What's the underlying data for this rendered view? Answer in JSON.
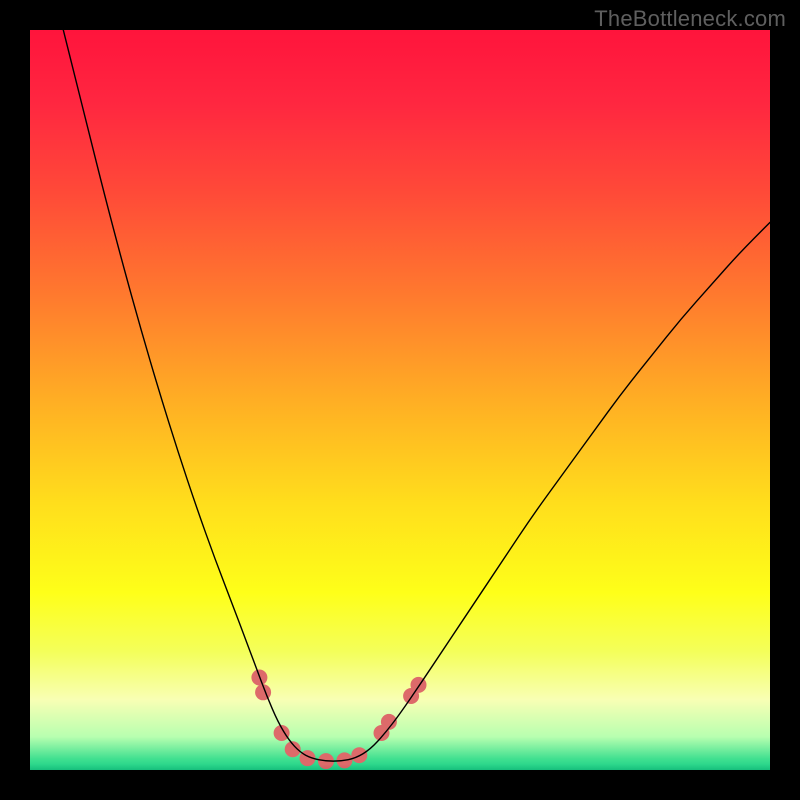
{
  "watermark": "TheBottleneck.com",
  "chart_data": {
    "type": "line",
    "title": "",
    "xlabel": "",
    "ylabel": "",
    "xlim": [
      0,
      100
    ],
    "ylim": [
      0,
      100
    ],
    "background_gradient_stops": [
      {
        "pos": 0.0,
        "color": "#ff143c"
      },
      {
        "pos": 0.1,
        "color": "#ff2740"
      },
      {
        "pos": 0.22,
        "color": "#ff4a38"
      },
      {
        "pos": 0.36,
        "color": "#ff7a2e"
      },
      {
        "pos": 0.5,
        "color": "#ffae24"
      },
      {
        "pos": 0.64,
        "color": "#ffde1c"
      },
      {
        "pos": 0.76,
        "color": "#feff19"
      },
      {
        "pos": 0.84,
        "color": "#f4ff5a"
      },
      {
        "pos": 0.905,
        "color": "#f8ffb4"
      },
      {
        "pos": 0.955,
        "color": "#b8ffb0"
      },
      {
        "pos": 0.985,
        "color": "#40e090"
      },
      {
        "pos": 1.0,
        "color": "#19cf87"
      }
    ],
    "series": [
      {
        "name": "curve",
        "stroke": "#000000",
        "stroke_width": 1.4,
        "points": [
          {
            "x": 4.5,
            "y": 100.0
          },
          {
            "x": 6.0,
            "y": 94.0
          },
          {
            "x": 8.0,
            "y": 86.0
          },
          {
            "x": 10.0,
            "y": 78.0
          },
          {
            "x": 12.5,
            "y": 68.5
          },
          {
            "x": 15.0,
            "y": 59.5
          },
          {
            "x": 17.5,
            "y": 51.0
          },
          {
            "x": 20.0,
            "y": 43.0
          },
          {
            "x": 22.5,
            "y": 35.5
          },
          {
            "x": 25.0,
            "y": 28.5
          },
          {
            "x": 27.5,
            "y": 22.0
          },
          {
            "x": 29.0,
            "y": 18.0
          },
          {
            "x": 30.5,
            "y": 14.0
          },
          {
            "x": 32.0,
            "y": 10.0
          },
          {
            "x": 33.5,
            "y": 6.5
          },
          {
            "x": 35.0,
            "y": 4.0
          },
          {
            "x": 36.5,
            "y": 2.4
          },
          {
            "x": 38.0,
            "y": 1.6
          },
          {
            "x": 40.0,
            "y": 1.2
          },
          {
            "x": 42.0,
            "y": 1.2
          },
          {
            "x": 44.0,
            "y": 1.6
          },
          {
            "x": 46.0,
            "y": 2.8
          },
          {
            "x": 48.0,
            "y": 5.0
          },
          {
            "x": 50.0,
            "y": 7.6
          },
          {
            "x": 53.0,
            "y": 12.0
          },
          {
            "x": 56.0,
            "y": 16.5
          },
          {
            "x": 60.0,
            "y": 22.5
          },
          {
            "x": 64.0,
            "y": 28.5
          },
          {
            "x": 68.0,
            "y": 34.5
          },
          {
            "x": 72.0,
            "y": 40.0
          },
          {
            "x": 76.0,
            "y": 45.5
          },
          {
            "x": 80.0,
            "y": 51.0
          },
          {
            "x": 84.0,
            "y": 56.0
          },
          {
            "x": 88.0,
            "y": 61.0
          },
          {
            "x": 92.0,
            "y": 65.5
          },
          {
            "x": 96.0,
            "y": 70.0
          },
          {
            "x": 100.0,
            "y": 74.0
          }
        ]
      }
    ],
    "markers": {
      "color": "#dd6a6a",
      "radius": 8,
      "points": [
        {
          "x": 31.0,
          "y": 12.5
        },
        {
          "x": 31.5,
          "y": 10.5
        },
        {
          "x": 34.0,
          "y": 5.0
        },
        {
          "x": 35.5,
          "y": 2.8
        },
        {
          "x": 37.5,
          "y": 1.6
        },
        {
          "x": 40.0,
          "y": 1.2
        },
        {
          "x": 42.5,
          "y": 1.3
        },
        {
          "x": 44.5,
          "y": 2.0
        },
        {
          "x": 47.5,
          "y": 5.0
        },
        {
          "x": 48.5,
          "y": 6.5
        },
        {
          "x": 51.5,
          "y": 10.0
        },
        {
          "x": 52.5,
          "y": 11.5
        }
      ]
    }
  }
}
